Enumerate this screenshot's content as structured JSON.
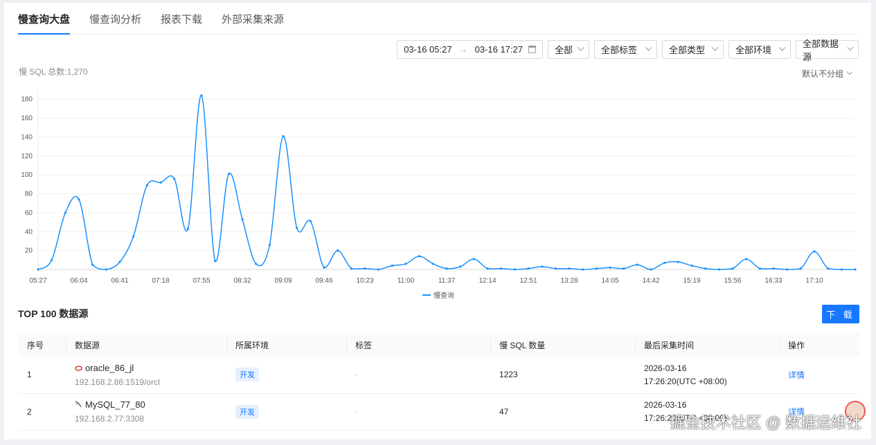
{
  "tabs": [
    {
      "label": "慢查询大盘",
      "active": true
    },
    {
      "label": "慢查询分析",
      "active": false
    },
    {
      "label": "报表下载",
      "active": false
    },
    {
      "label": "外部采集来源",
      "active": false
    }
  ],
  "filters": {
    "range_start": "03-16 05:27",
    "range_end": "03-16 17:27",
    "arrow": "→",
    "selects": [
      "全部",
      "全部标签",
      "全部类型",
      "全部环境",
      "全部数据源"
    ]
  },
  "summary": {
    "total_text": "慢 SQL 总数:1,270",
    "group_label": "默认不分组"
  },
  "chart_data": {
    "type": "line",
    "xlabel": "",
    "ylabel": "",
    "ylim": [
      0,
      190
    ],
    "yticks": [
      20,
      40,
      60,
      80,
      100,
      120,
      140,
      160,
      180
    ],
    "grid": true,
    "legend": "bottom-center",
    "series": [
      {
        "name": "慢查询",
        "color": "#1890ff",
        "values": [
          0,
          10,
          60,
          74,
          5,
          0,
          8,
          35,
          89,
          92,
          96,
          43,
          184,
          9,
          101,
          53,
          6,
          26,
          141,
          44,
          51,
          2,
          20,
          1,
          1,
          0,
          4,
          6,
          14,
          6,
          1,
          3,
          11,
          1,
          1,
          0,
          1,
          3,
          1,
          1,
          0,
          1,
          2,
          1,
          5,
          0,
          7,
          8,
          4,
          1,
          0,
          1,
          11,
          1,
          1,
          0,
          1,
          19,
          1,
          0,
          0
        ]
      }
    ],
    "x_tick_labels": [
      "05:27",
      "06:04",
      "06:41",
      "07:18",
      "07:55",
      "08:32",
      "09:09",
      "09:46",
      "10:23",
      "11:00",
      "11:37",
      "12:14",
      "12:51",
      "13:28",
      "14:05",
      "14:42",
      "15:19",
      "15:56",
      "16:33",
      "17:10"
    ]
  },
  "section": {
    "title": "TOP 100 数据源",
    "download_label": "下 载"
  },
  "table": {
    "columns": [
      "序号",
      "数据源",
      "所属环境",
      "标签",
      "慢 SQL 数量",
      "最后采集时间",
      "操作"
    ],
    "rows": [
      {
        "index": "1",
        "name": "oracle_86_jl",
        "addr": "192.168.2.86:1519/orcl",
        "env": "开发",
        "tag": "-",
        "count": "1223",
        "date": "2026-03-16",
        "time": "17:26:20(UTC +08:00)",
        "action": "详情",
        "db_icon": "oracle-icon"
      },
      {
        "index": "2",
        "name": "MySQL_77_80",
        "addr": "192.168.2.77:3308",
        "env": "开发",
        "tag": "-",
        "count": "47",
        "date": "2026-03-16",
        "time": "17:26:20(UTC +08:00)",
        "action": "详情",
        "db_icon": "mysql-icon"
      }
    ]
  },
  "watermark": "掘金技术社区 @ 数据运维社"
}
